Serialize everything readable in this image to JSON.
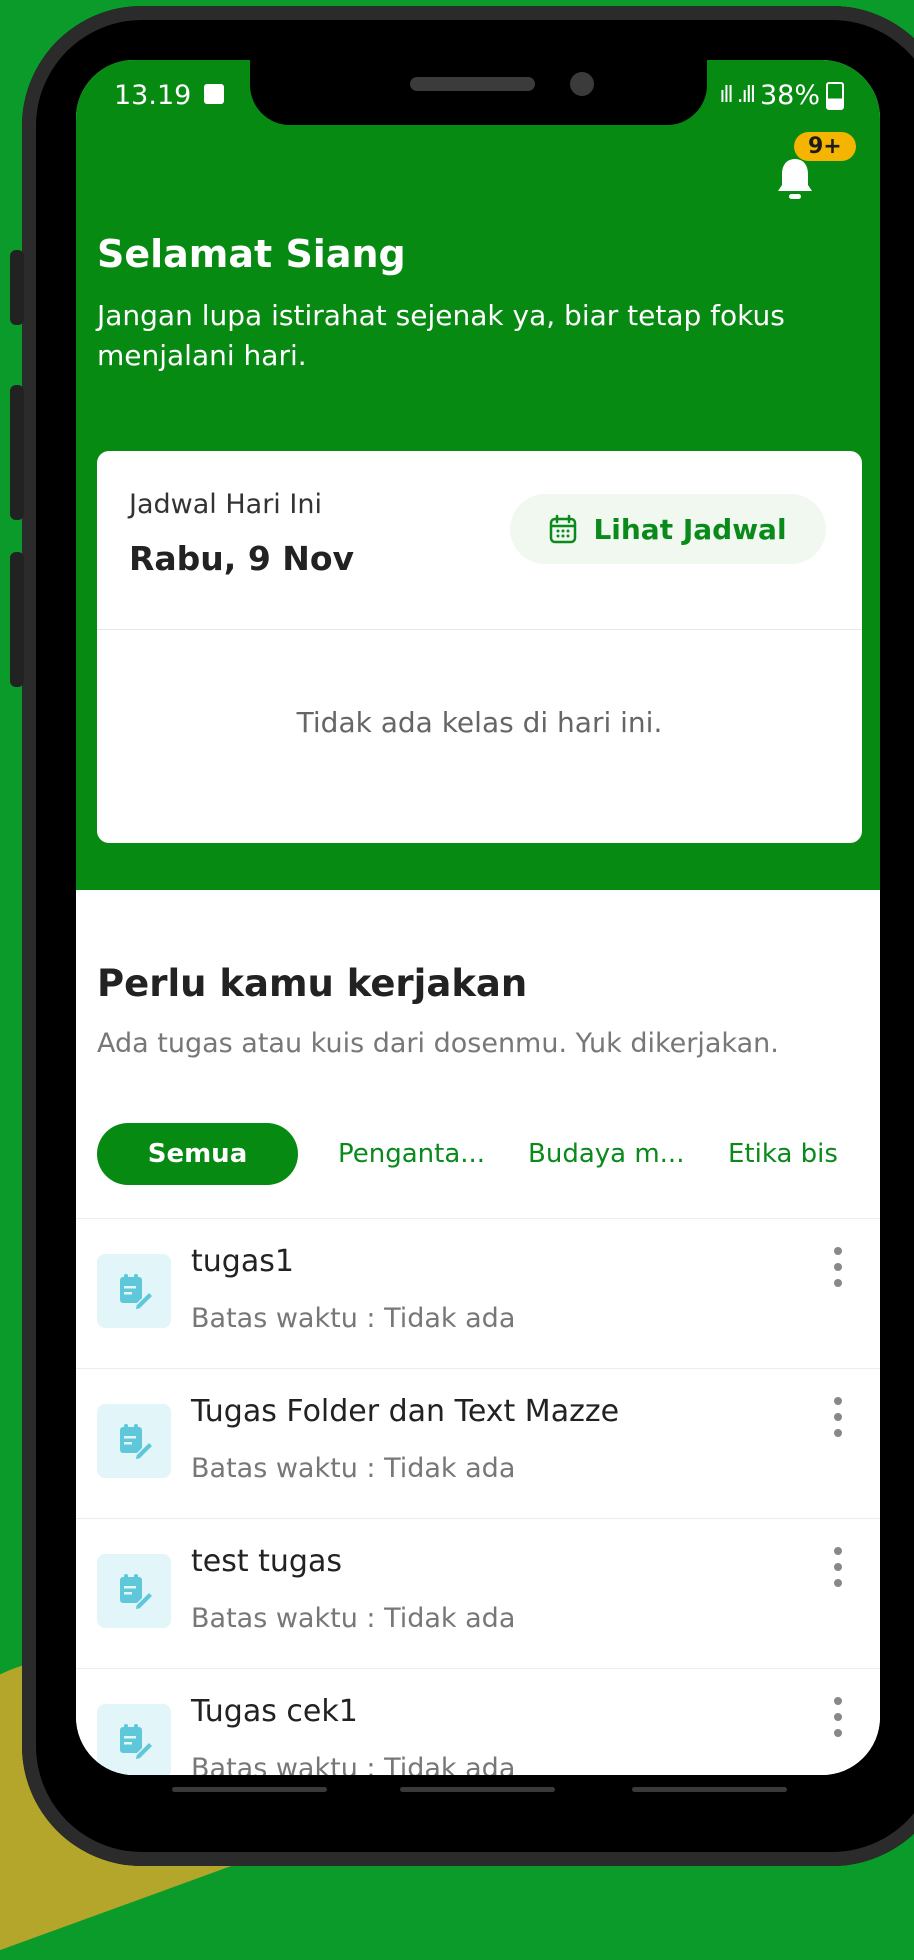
{
  "status_bar": {
    "time": "13.19",
    "signal": " ıll .ıll",
    "battery": "38%"
  },
  "notification": {
    "badge": "9+"
  },
  "greeting": {
    "title": "Selamat Siang",
    "subtitle": "Jangan lupa istirahat sejenak ya, biar tetap fokus menjalani hari."
  },
  "schedule_card": {
    "label": "Jadwal Hari Ini",
    "date": "Rabu, 9 Nov",
    "button_label": "Lihat Jadwal",
    "empty_message": "Tidak ada kelas di hari ini."
  },
  "tasks_section": {
    "title": "Perlu kamu kerjakan",
    "subtitle": "Ada tugas atau kuis dari dosenmu. Yuk dikerjakan.",
    "tabs": [
      {
        "label": "Semua"
      },
      {
        "label": "Penganta..."
      },
      {
        "label": "Budaya m..."
      },
      {
        "label": "Etika bis"
      }
    ],
    "items": [
      {
        "title": "tugas1",
        "deadline": "Batas waktu : Tidak ada"
      },
      {
        "title": "Tugas Folder dan Text Mazze",
        "deadline": "Batas waktu : Tidak ada"
      },
      {
        "title": "test tugas",
        "deadline": "Batas waktu : Tidak ada"
      },
      {
        "title": "Tugas cek1",
        "deadline": "Batas waktu : Tidak ada"
      }
    ]
  },
  "colors": {
    "primary": "#078a12",
    "badge": "#f4b400",
    "icon_bg": "#e2f5f8"
  }
}
